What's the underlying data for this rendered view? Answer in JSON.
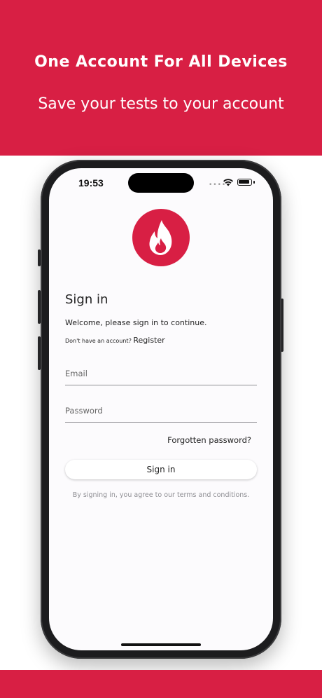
{
  "banner": {
    "headline": "One Account For All Devices",
    "subline": "Save your tests to your account"
  },
  "status_bar": {
    "time": "19:53"
  },
  "signin": {
    "title": "Sign in",
    "welcome": "Welcome, please sign in to continue.",
    "no_account_text": "Don't have an account?",
    "register_label": "Register",
    "email_placeholder": "Email",
    "password_placeholder": "Password",
    "forgot_label": "Forgotten password?",
    "button_label": "Sign in",
    "terms": "By signing in, you agree to our terms and conditions."
  },
  "colors": {
    "brand_red": "#d81f44",
    "screen_bg": "#fcfbfd"
  },
  "icons": {
    "logo": "flame-icon"
  }
}
